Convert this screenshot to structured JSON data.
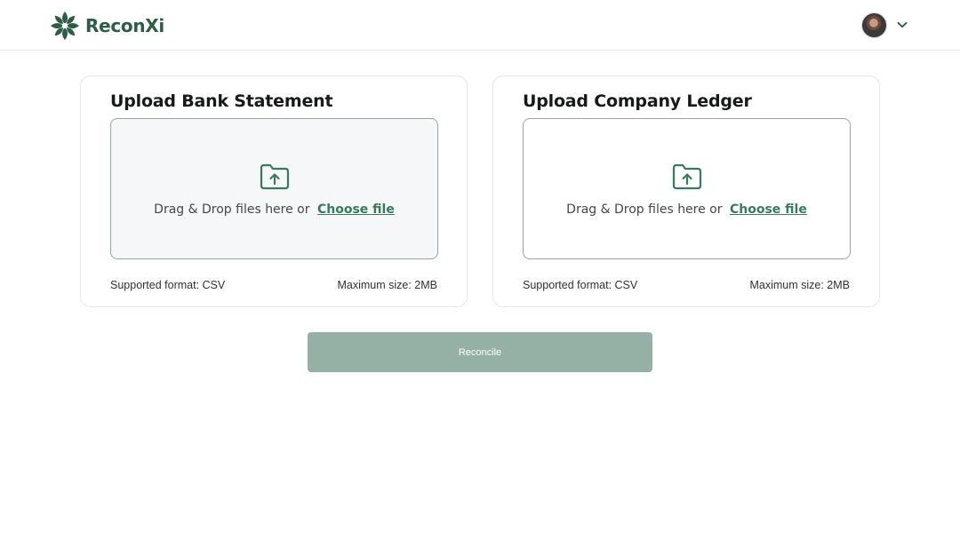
{
  "app": {
    "brand_name": "ReconXi",
    "accent_color": "#2d5e45",
    "link_color": "#3a7a5c",
    "button_color": "#95b0a4"
  },
  "header": {
    "logo_icon": "flower-logo-icon",
    "user_menu_icon": "chevron-down-icon"
  },
  "cards": [
    {
      "title": "Upload Bank Statement",
      "icon": "folder-upload-icon",
      "drop_text": "Drag & Drop files here or",
      "choose_label": "Choose file",
      "format_text": "Supported format: CSV",
      "size_text": "Maximum size: 2MB"
    },
    {
      "title": "Upload Company Ledger",
      "icon": "folder-upload-icon",
      "drop_text": "Drag & Drop files here or",
      "choose_label": "Choose file",
      "format_text": "Supported format: CSV",
      "size_text": "Maximum size: 2MB"
    }
  ],
  "actions": {
    "reconcile_label": "Reconcile"
  }
}
